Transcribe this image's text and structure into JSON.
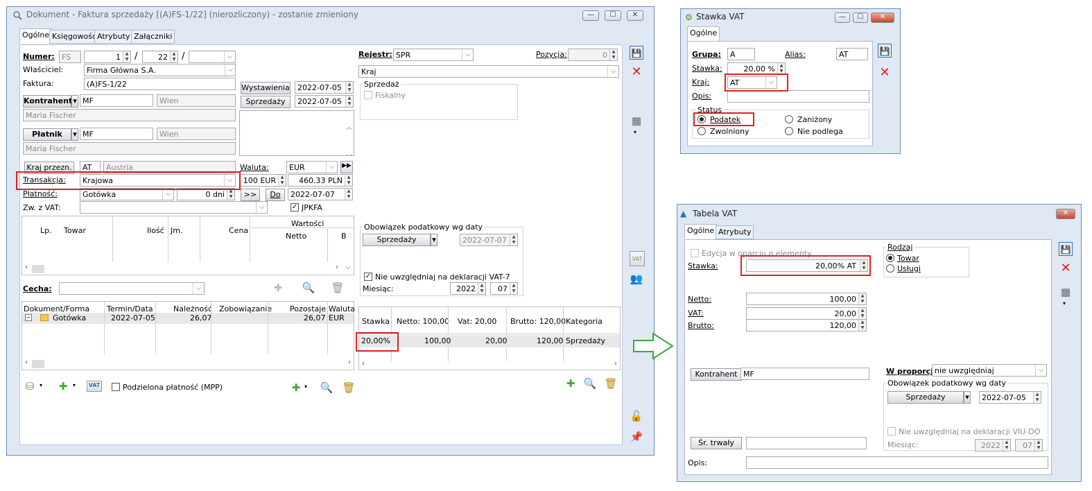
{
  "doc_window": {
    "title": "Dokument - Faktura sprzedaży [(A)FS-1/22] (nierozliczony) - zostanie zmieniony",
    "tabs": [
      "Ogólne",
      "Księgowość",
      "Atrybuty",
      "Załączniki"
    ],
    "numer_label": "Numer:",
    "numer_prefix": "FS",
    "numer_no": "1",
    "numer_year": "22",
    "numer_sep": "/",
    "wlasciciel_label": "Właściciel:",
    "wlasciciel_value": "Firma Główna S.A.",
    "faktura_label": "Faktura:",
    "faktura_value": "(A)FS-1/22",
    "kontrahent_btn": "Kontrahent",
    "kontrahent_code": "MF",
    "kontrahent_city": "Wien",
    "kontrahent_name": "Maria Fischer",
    "platnik_btn": "Płatnik",
    "platnik_code": "MF",
    "platnik_city": "Wien",
    "platnik_name": "Maria Fischer",
    "wystawienia_btn": "Wystawienia",
    "wystawienia_date": "2022-07-05",
    "sprzedazy_btn": "Sprzedaży",
    "sprzedazy_date": "2022-07-05",
    "kraj_btn": "Kraj przezn.",
    "kraj_code": "AT",
    "kraj_name": "Austria",
    "waluta_label": "Waluta:",
    "waluta_value": "EUR",
    "transakcja_label": "Transakcja:",
    "transakcja_value": "Krajowa",
    "kurs_from": "100 EUR",
    "kurs_to": "460.33 PLN",
    "platnosc_label": "Płatność:",
    "platnosc_value": "Gotówka",
    "platnosc_days": "0 dni",
    "do_btn": "Do",
    "arrows_btn": ">>",
    "platnosc_date": "2022-07-07",
    "zwvat_label": "Zw. z VAT:",
    "jpkfa_label": "JPKFA",
    "rejestr_label": "Rejestr:",
    "rejestr_value": "SPR",
    "pozycja_label": "Pozycja:",
    "pozycja_value": "0",
    "kraj_combo": "Kraj",
    "sprzedaz_group": "Sprzedaż",
    "fiskalny_label": "Fiskalny",
    "items_headers": [
      "Lp.",
      "Towar",
      "Ilość",
      "Jm.",
      "Cena",
      "Wartości",
      "Netto",
      "B"
    ],
    "cecha_label": "Cecha:",
    "obowiazek_group": "Obowiązek podatkowy wg daty",
    "obowiazek_btn": "Sprzedaży",
    "obowiazek_date": "2022-07-07",
    "vat7_label": "Nie uwzględniaj na deklaracji VAT-7",
    "miesiac_label": "Miesiąc:",
    "miesiac_year": "2022",
    "miesiac_month": "07",
    "pay_headers": [
      "Dokument/Forma",
      "Termin/Data",
      "Należność",
      "Zobowiązanie",
      "Pozostaje",
      "Waluta"
    ],
    "pay_row": [
      "Gotówka",
      "2022-07-05",
      "26,07",
      "",
      "26,07",
      "EUR"
    ],
    "vat_headers": [
      "Stawka",
      "Netto: 100,00",
      "Vat: 20,00",
      "Brutto: 120,00",
      "Kategoria"
    ],
    "vat_row": [
      "20,00%",
      "100,00",
      "20,00",
      "120,00",
      "Sprzedaży"
    ],
    "mpp_label": "Podzielona płatność (MPP)",
    "vat_icon_text": "VAT"
  },
  "stawka_window": {
    "title": "Stawka VAT",
    "tab": "Ogólne",
    "grupa_label": "Grupa:",
    "grupa_value": "A",
    "alias_label": "Alias:",
    "alias_value": "AT",
    "stawka_label": "Stawka:",
    "stawka_value": "20,00 %",
    "kraj_label": "Kraj:",
    "kraj_value": "AT",
    "opis_label": "Opis:",
    "status_label": "Status",
    "podatek": "Podatek",
    "zanizony": "Zaniżony",
    "zwolniony": "Zwolniony",
    "nie_podlega": "Nie podlega"
  },
  "tabela_window": {
    "title": "Tabela VAT",
    "tabs": [
      "Ogólne",
      "Atrybuty"
    ],
    "edycja_label": "Edycja w oparciu o elementy",
    "rodzaj_label": "Rodzaj",
    "towar": "Towar",
    "uslugi": "Usługi",
    "stawka_label": "Stawka:",
    "stawka_value": "20,00% AT",
    "netto_label": "Netto:",
    "netto_value": "100,00",
    "vat_label": "VAT:",
    "vat_value": "20,00",
    "brutto_label": "Brutto:",
    "brutto_value": "120,00",
    "kontrahent_btn": "Kontrahent",
    "kontrahent_value": "MF",
    "proporcji_label": "W proporcji:",
    "proporcji_value": "nie uwzględniaj",
    "obowiazek_group": "Obowiązek podatkowy wg daty",
    "obowiazek_btn": "Sprzedaży",
    "obowiazek_date": "2022-07-05",
    "viudo_label": "Nie uwzględniaj na deklaracji VIU-DO",
    "miesiac_label": "Miesiąc:",
    "miesiac_year": "2022",
    "miesiac_month": "07",
    "srtrwaly_btn": "Śr. trwały",
    "opis_label": "Opis:"
  },
  "colors": {
    "highlight": "#e0201c",
    "arrow": "#3aa843",
    "accent": "#2f6db5"
  }
}
